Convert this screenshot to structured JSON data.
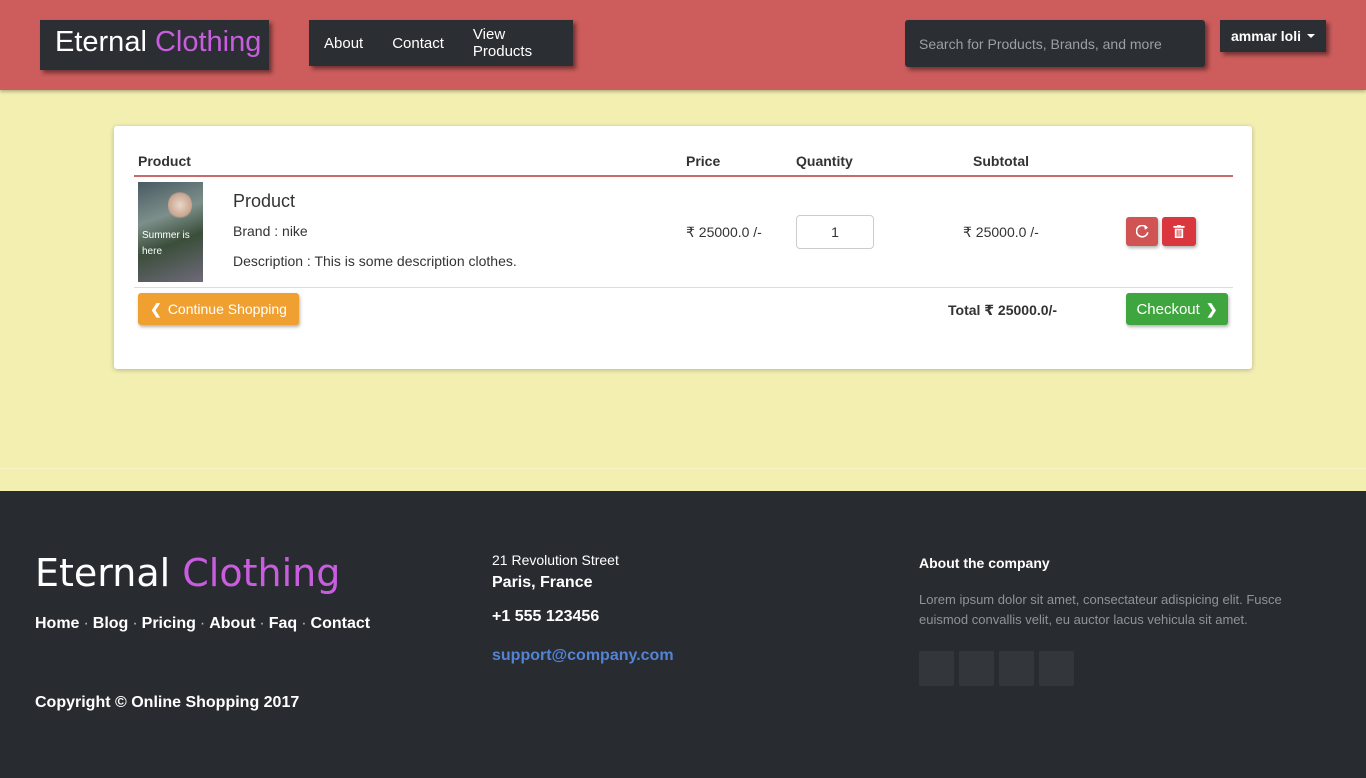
{
  "header": {
    "brand_part1": "Eternal",
    "brand_part2": "Clothing",
    "nav": [
      "About",
      "Contact",
      "View Products"
    ],
    "search_placeholder": "Search for Products, Brands, and more",
    "user_name": "ammar loli"
  },
  "cart": {
    "columns": {
      "product": "Product",
      "price": "Price",
      "quantity": "Quantity",
      "subtotal": "Subtotal"
    },
    "item": {
      "thumb_text": "Summer is here",
      "name": "Product",
      "brand": "Brand : nike",
      "description": "Description : This is some description clothes.",
      "price": "₹ 25000.0 /-",
      "quantity": "1",
      "subtotal": "₹ 25000.0 /-"
    },
    "continue_label": "Continue Shopping",
    "total": "Total ₹ 25000.0/-",
    "checkout_label": "Checkout"
  },
  "footer": {
    "brand_part1": "Eternal",
    "brand_part2": "Clothing",
    "links": [
      "Home",
      "Blog",
      "Pricing",
      "About",
      "Faq",
      "Contact"
    ],
    "copyright": "Copyright © Online Shopping 2017",
    "street": "21 Revolution Street",
    "city": "Paris, France",
    "phone": "+1 555 123456",
    "email": "support@company.com",
    "about_heading": "About the company",
    "about_text": "Lorem ipsum dolor sit amet, consectateur adispicing elit. Fusce euismod convallis velit, eu auctor lacus vehicula sit amet."
  },
  "colors": {
    "header_bg": "#cd5c5c",
    "page_bg": "#f3efb1",
    "dark": "#2b2e33",
    "brand_accent": "#c95de0",
    "footer_bg": "#282b30"
  }
}
